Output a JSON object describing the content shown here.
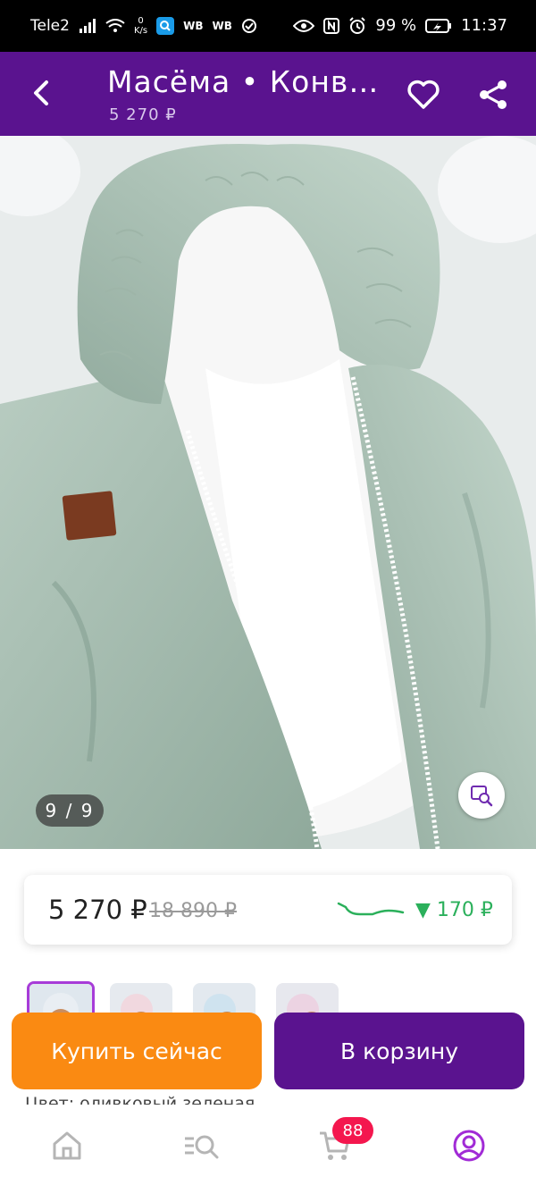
{
  "status_bar": {
    "carrier": "Tele2",
    "net_speed_value": "0",
    "net_speed_unit": "K/s",
    "app_labels": [
      "WB",
      "WB"
    ],
    "battery": "99 %",
    "time": "11:37"
  },
  "header": {
    "title": "Масёма  •  Конв…",
    "subtitle": "5 270 ₽"
  },
  "gallery": {
    "counter": "9 / 9"
  },
  "price_card": {
    "price": "5 270 ₽",
    "old_price": "18 890 ₽",
    "drop": "▼ 170 ₽"
  },
  "actions": {
    "buy_now": "Купить сейчас",
    "add_to_cart": "В корзину"
  },
  "details_peek": "Цвет: оливковый зеленая",
  "nav": {
    "cart_badge": "88"
  },
  "colors": {
    "brand_purple": "#5a138f",
    "buy_orange": "#fa8a12",
    "price_drop_green": "#2bb05b",
    "badge_red": "#f4174e"
  },
  "icons": [
    "back-arrow-icon",
    "heart-icon",
    "share-icon",
    "visual-search-icon",
    "home-icon",
    "catalog-search-icon",
    "cart-icon",
    "profile-icon"
  ]
}
